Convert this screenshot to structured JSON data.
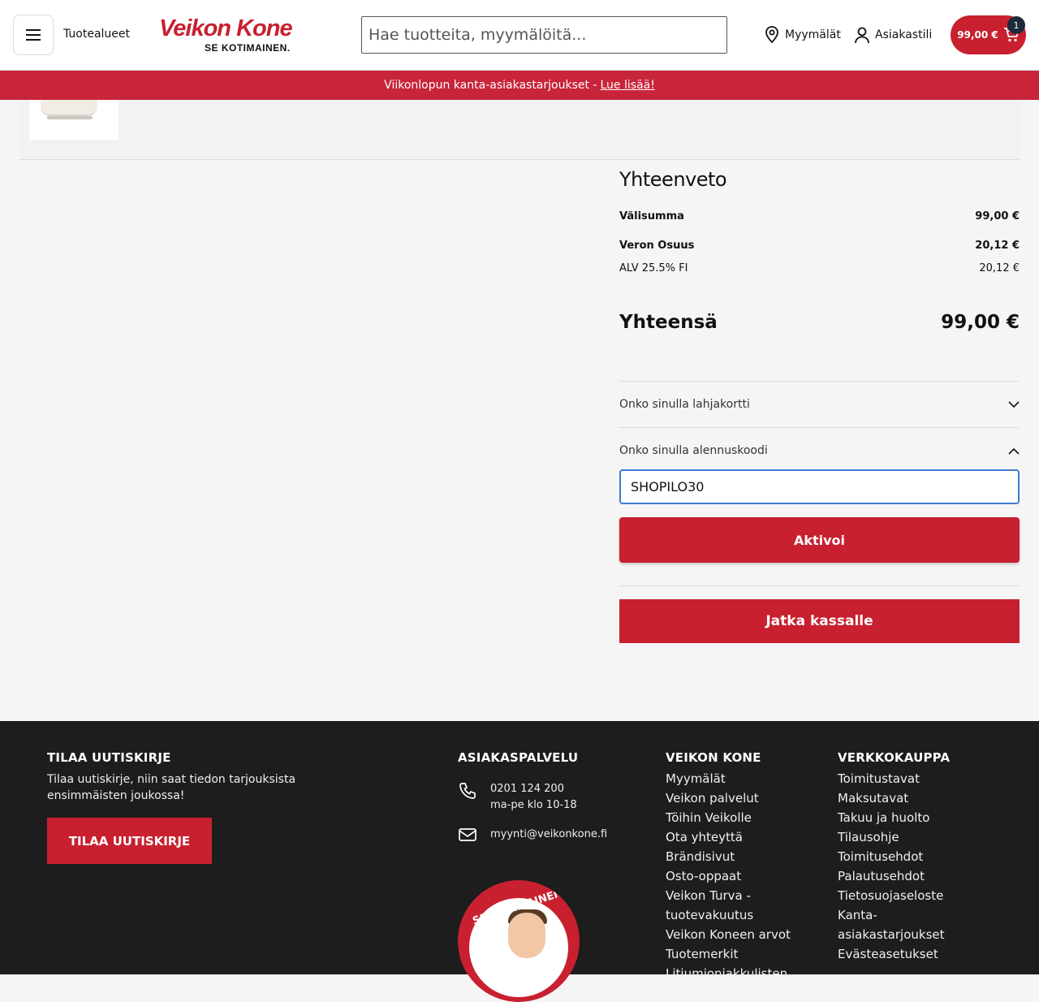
{
  "header": {
    "menu_label": "Tuotealueet",
    "logo_main": "Veikon Kone",
    "logo_sub": "SE KOTIMAINEN.",
    "search_placeholder": "Hae tuotteita, myymälöitä...",
    "stores_label": "Myymälät",
    "account_label": "Asiakastili",
    "cart_total": "99,00 €",
    "cart_count": "1"
  },
  "promo": {
    "text": "Viikonlopun kanta-asiakastarjoukset -",
    "link": "Lue lisää!"
  },
  "summary": {
    "title": "Yhteenveto",
    "subtotal_label": "Välisumma",
    "subtotal_value": "99,00 €",
    "tax_label": "Veron Osuus",
    "tax_value": "20,12 €",
    "vat_label": "ALV 25.5% FI",
    "vat_value": "20,12 €",
    "total_label": "Yhteensä",
    "total_value": "99,00 €",
    "giftcard_label": "Onko sinulla lahjakortti",
    "discount_label": "Onko sinulla alennuskoodi",
    "discount_code": "SHOPILO30",
    "activate_label": "Aktivoi",
    "checkout_label": "Jatka kassalle"
  },
  "footer": {
    "newsletter_title": "TILAA UUTISKIRJE",
    "newsletter_text": "Tilaa uutiskirje, niin saat tiedon tarjouksista ensimmäisten joukossa!",
    "newsletter_button": "TILAA UUTISKIRJE",
    "service_title": "ASIAKASPALVELU",
    "phone": "0201 124 200",
    "hours": "ma-pe klo 10-18",
    "email": "myynti@veikonkone.fi",
    "badge_text": "SE KOTIMAINEN",
    "col1_title": "VEIKON KONE",
    "col1_items": [
      "Myymälät",
      "Veikon palvelut",
      "Töihin Veikolle",
      "Ota yhteyttä",
      "Brändisivut",
      "Osto-oppaat",
      "Veikon Turva -",
      "tuotevakuutus",
      "Veikon Koneen arvot",
      "Tuotemerkit",
      "Litiumioniakkulisten"
    ],
    "col2_title": "VERKKOKAUPPA",
    "col2_items": [
      "Toimitustavat",
      "Maksutavat",
      "Takuu ja huolto",
      "Tilausohje",
      "Toimitusehdot",
      "Palautusehdot",
      "Tietosuojaseloste",
      "Kanta-",
      "asiakastarjoukset",
      "Evästeasetukset"
    ]
  },
  "colors": {
    "brand_red": "#c8202f",
    "focus_blue": "#3b7bd4",
    "footer_bg": "#1d1d1d"
  }
}
